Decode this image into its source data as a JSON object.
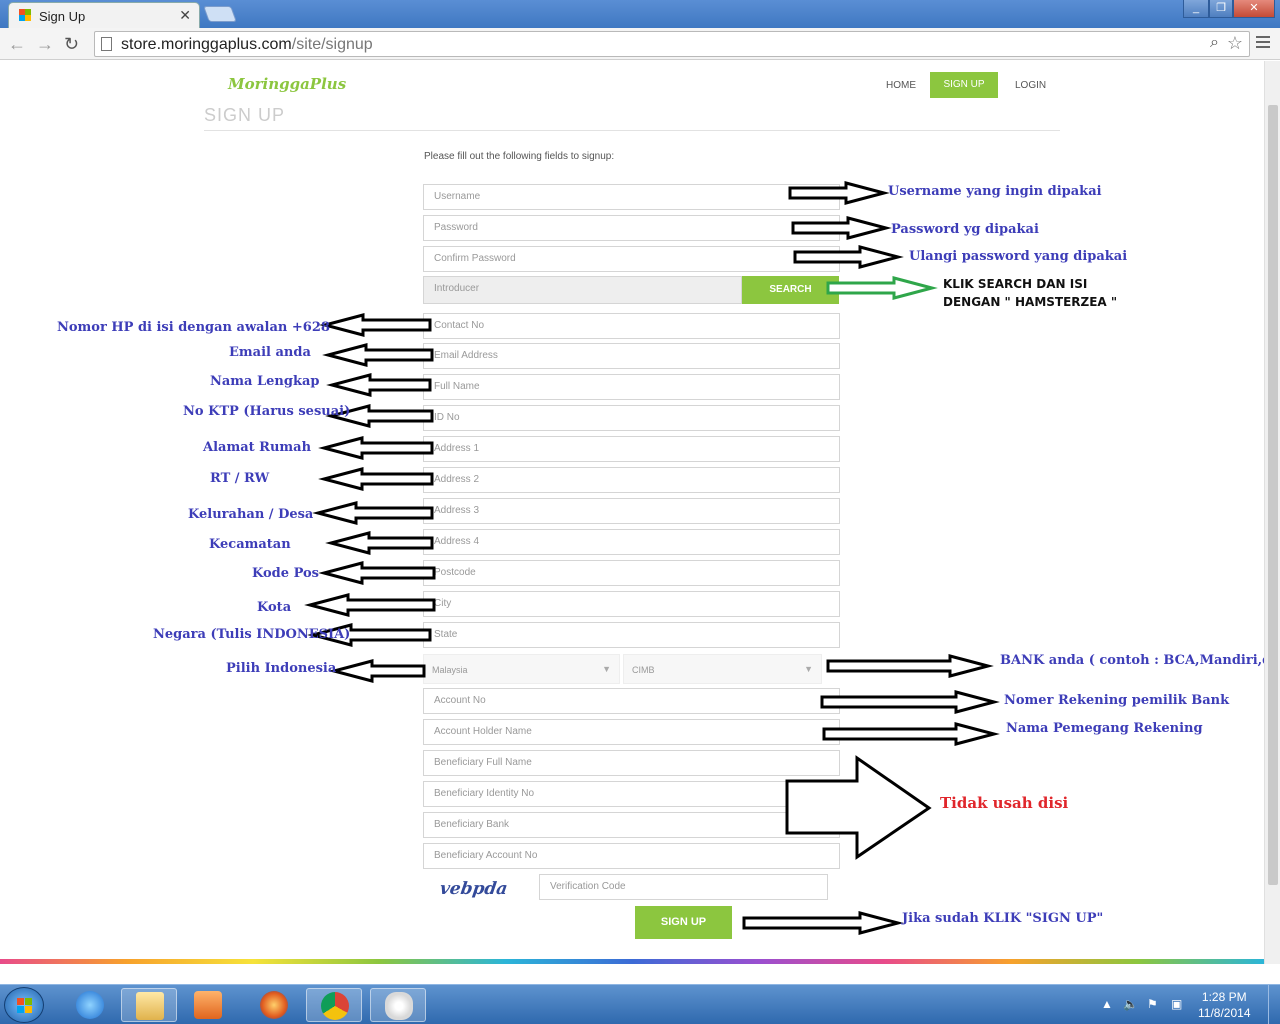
{
  "browser": {
    "tab_title": "Sign Up",
    "tab_close": "✕",
    "url_host": "store.moringgaplus.com",
    "url_path": "/site/signup"
  },
  "site": {
    "logo_text": "MoringgaPlus",
    "nav": {
      "home": "HOME",
      "signup": "SIGN UP",
      "login": "LOGIN"
    },
    "heading": "SIGN UP",
    "intro": "Please fill out the following fields to signup:"
  },
  "form": {
    "fields": [
      "Username",
      "Password",
      "Confirm Password",
      "Introducer",
      "Contact No",
      "Email Address",
      "Full Name",
      "ID No",
      "Address 1",
      "Address 2",
      "Address 3",
      "Address 4",
      "Postcode",
      "City",
      "State",
      "Account No",
      "Account Holder Name",
      "Beneficiary Full Name",
      "Beneficiary Identity No",
      "Beneficiary Bank",
      "Beneficiary Account No",
      "Verification Code"
    ],
    "search_button": "SEARCH",
    "country_select": "Malaysia",
    "bank_select": "CIMB",
    "captcha_text": "vebpda",
    "submit_button": "SIGN UP"
  },
  "annotations": {
    "username": "Username yang ingin dipakai",
    "password": "Password yg dipakai",
    "confirm": "Ulangi password yang dipakai",
    "search_1": "KLIK SEARCH DAN ISI",
    "search_2": "DENGAN \" HAMSTERZEA \"",
    "contact": "Nomor HP di isi dengan awalan +628",
    "email": "Email anda",
    "fullname": "Nama Lengkap",
    "idno": "No KTP (Harus sesuai)",
    "address1": "Alamat Rumah",
    "address2": "RT / RW",
    "address3": "Kelurahan / Desa",
    "address4": "Kecamatan",
    "postcode": "Kode Pos",
    "city": "Kota",
    "state": "Negara (Tulis INDONESIA)",
    "country": "Pilih Indonesia",
    "bank": "BANK anda ( contoh :    BCA,Mandiri,dll",
    "account_no": "Nomer Rekening pemilik Bank",
    "account_holder": "Nama Pemegang Rekening",
    "beneficiary": "Tidak usah disi",
    "submit": "Jika sudah KLIK \"SIGN UP\""
  },
  "taskbar": {
    "time": "1:28 PM",
    "date": "11/8/2014"
  }
}
